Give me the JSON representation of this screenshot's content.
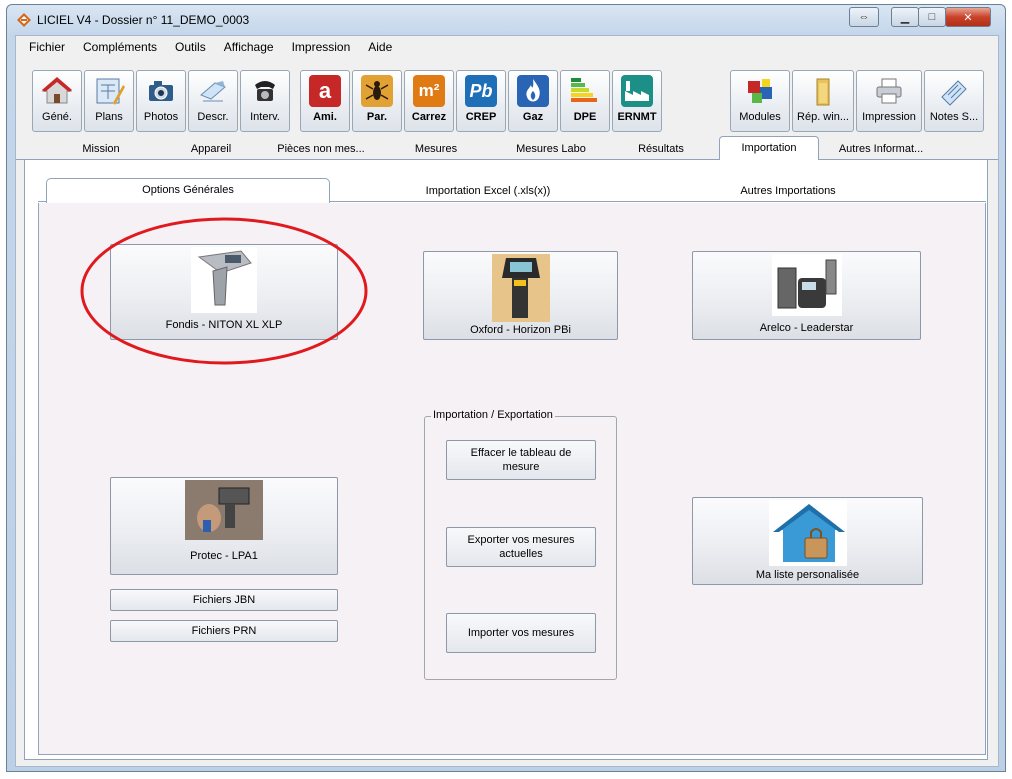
{
  "window": {
    "title": "LICIEL V4 - Dossier n° 11_DEMO_0003",
    "controls": {
      "restore": "⇔",
      "minimize": "▁",
      "maximize": "□",
      "close": "✕"
    }
  },
  "menu": [
    {
      "label": "Fichier"
    },
    {
      "label": "Compléments"
    },
    {
      "label": "Outils"
    },
    {
      "label": "Affichage"
    },
    {
      "label": "Impression"
    },
    {
      "label": "Aide"
    }
  ],
  "toolbar": {
    "left": [
      {
        "label": "Géné.",
        "icon": "house-icon"
      },
      {
        "label": "Plans",
        "icon": "plans-icon"
      },
      {
        "label": "Photos",
        "icon": "camera-icon"
      },
      {
        "label": "Descr.",
        "icon": "description-icon"
      },
      {
        "label": "Interv.",
        "icon": "phone-icon"
      },
      {
        "label": "Ami.",
        "icon": "amiante-icon",
        "glyph": "a"
      },
      {
        "label": "Par.",
        "icon": "termite-icon"
      },
      {
        "label": "Carrez",
        "icon": "carrez-icon",
        "glyph": "m²"
      },
      {
        "label": "CREP",
        "icon": "crep-icon",
        "glyph": "Pb"
      },
      {
        "label": "Gaz",
        "icon": "gas-flame-icon"
      },
      {
        "label": "DPE",
        "icon": "dpe-icon"
      },
      {
        "label": "ERNMT",
        "icon": "factory-icon"
      }
    ],
    "right": [
      {
        "label": "Modules",
        "icon": "modules-icon"
      },
      {
        "label": "Rép. win...",
        "icon": "folder-icon"
      },
      {
        "label": "Impression",
        "icon": "printer-icon"
      },
      {
        "label": "Notes S...",
        "icon": "notes-icon"
      }
    ]
  },
  "main_tabs": [
    {
      "label": "Mission"
    },
    {
      "label": "Appareil"
    },
    {
      "label": "Pièces non mes..."
    },
    {
      "label": "Mesures"
    },
    {
      "label": "Mesures Labo"
    },
    {
      "label": "Résultats"
    },
    {
      "label": "Importation",
      "active": true
    },
    {
      "label": "Autres Informat..."
    }
  ],
  "sub_tabs": [
    {
      "label": "Options Générales",
      "active": true
    },
    {
      "label": "Importation Excel (.xls(x))"
    },
    {
      "label": "Autres Importations"
    }
  ],
  "devices": {
    "fondis": "Fondis - NITON XL XLP",
    "oxford": "Oxford - Horizon PBi",
    "arelco": "Arelco - Leaderstar",
    "protec": "Protec - LPA1",
    "ma_liste": "Ma liste personalisée"
  },
  "files": {
    "jbn": "Fichiers JBN",
    "prn": "Fichiers PRN"
  },
  "import_export": {
    "title": "Importation / Exportation",
    "clear": "Effacer le tableau de mesure",
    "export": "Exporter vos mesures actuelles",
    "import": "Importer vos mesures"
  },
  "colors": {
    "annotation": "#e0191e",
    "amiante": "#c62828",
    "crep": "#1e6fb8",
    "carrez": "#e07b14",
    "gaz": "#2a64b5",
    "ernmt": "#1c8f86"
  }
}
